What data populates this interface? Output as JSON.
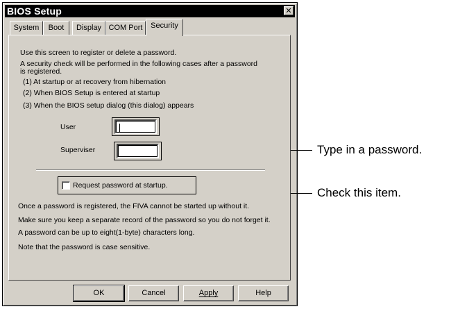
{
  "window": {
    "title": "BIOS Setup",
    "close_glyph": "✕"
  },
  "tabs": [
    {
      "label": "System"
    },
    {
      "label": "Boot"
    },
    {
      "label": "Display"
    },
    {
      "label": "COM Port"
    },
    {
      "label": "Security"
    }
  ],
  "active_tab": "Security",
  "intro": {
    "line1": "Use this screen to register or delete a password.",
    "line2": "A security check will be performed in the following cases after a password",
    "line3": "is registered.",
    "cases": [
      "(1) At startup or at recovery from hibernation",
      "(2) When BIOS Setup is entered at startup",
      "(3) When the BIOS setup dialog (this dialog) appears"
    ]
  },
  "fields": {
    "user_label": "User",
    "user_value": "",
    "superviser_label": "Superviser",
    "superviser_value": ""
  },
  "checkbox": {
    "label": "Request password at startup.",
    "checked": false
  },
  "notes": [
    "Once a password is registered, the FIVA cannot be started up without it.",
    "Make sure you keep a separate record of the password so you do not forget it.",
    "A password can be up to eight(1-byte)  characters long.",
    "Note that the password is case sensitive."
  ],
  "buttons": {
    "ok": "OK",
    "cancel": "Cancel",
    "apply": "Apply",
    "help": "Help"
  },
  "callouts": {
    "password": "Type in a password.",
    "check": "Check this item."
  }
}
